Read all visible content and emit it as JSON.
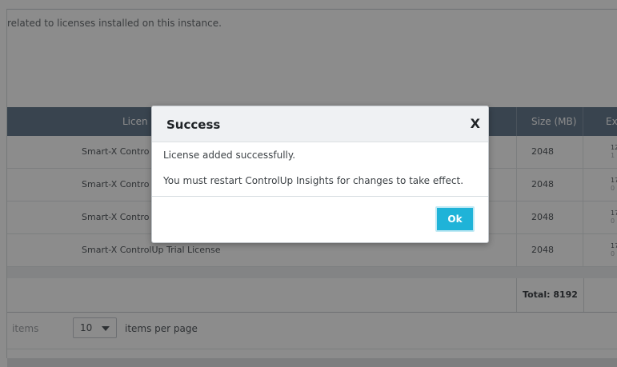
{
  "page": {
    "description": "related to licenses installed on this instance."
  },
  "table": {
    "columns": [
      "Licen",
      "Size (MB)",
      "Ex"
    ],
    "rows": [
      {
        "name": "Smart-X Contro",
        "size": "2048",
        "exp_top": "12",
        "exp_bottom": "1"
      },
      {
        "name": "Smart-X Contro",
        "size": "2048",
        "exp_top": "17",
        "exp_bottom": "0"
      },
      {
        "name": "Smart-X Contro",
        "size": "2048",
        "exp_top": "17",
        "exp_bottom": "0"
      },
      {
        "name": "Smart-X ControlUp Trial License",
        "size": "2048",
        "exp_top": "17",
        "exp_bottom": "0"
      }
    ],
    "total": "Total: 8192"
  },
  "pager": {
    "items_label": "items",
    "page_size": "10",
    "per_page_label": "items per page"
  },
  "dialog": {
    "title": "Success",
    "close": "X",
    "message1": "License added successfully.",
    "message2": "You must restart ControlUp Insights for changes to take effect.",
    "ok": "Ok"
  },
  "colors": {
    "header_bg": "#697c90",
    "ok_button": "#1fb3d8",
    "overlay": "rgba(0,0,0,0.45)"
  }
}
